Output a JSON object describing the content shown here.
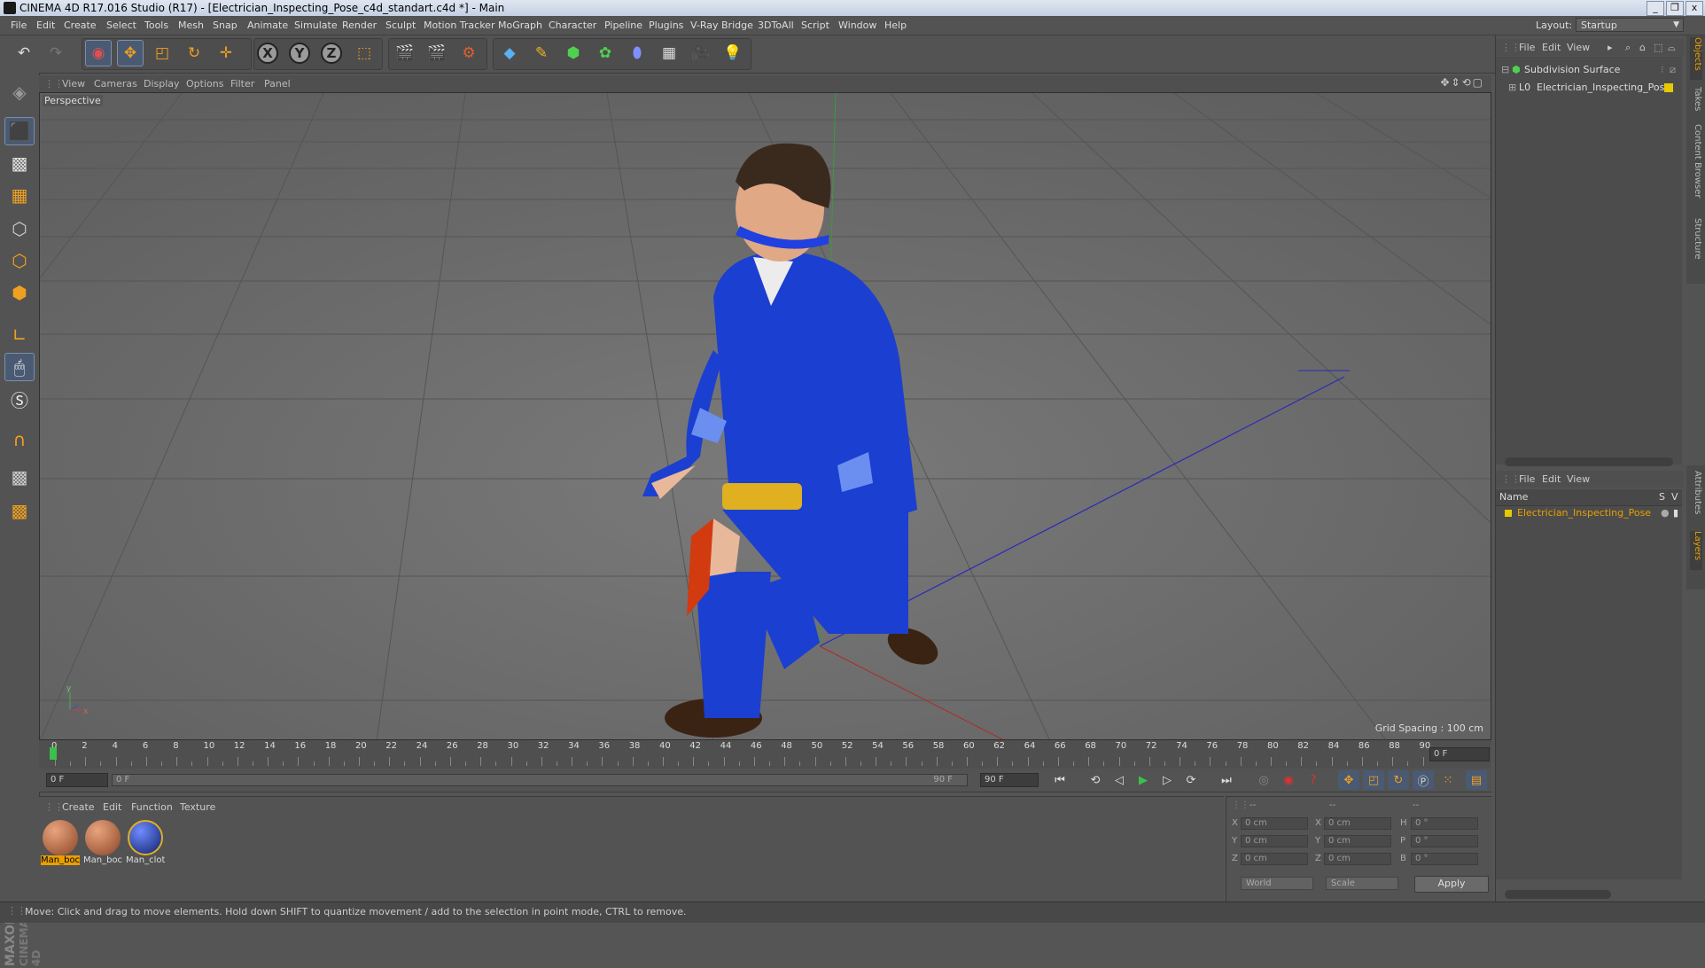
{
  "window": {
    "title": "CINEMA 4D R17.016 Studio (R17) - [Electrician_Inspecting_Pose_c4d_standart.c4d *] - Main",
    "controls": [
      "_",
      "❐",
      "x"
    ]
  },
  "menubar": {
    "items": [
      "File",
      "Edit",
      "Create",
      "Select",
      "Tools",
      "Mesh",
      "Snap",
      "Animate",
      "Simulate",
      "Render",
      "Sculpt",
      "Motion Tracker",
      "MoGraph",
      "Character",
      "Pipeline",
      "Plugins",
      "V-Ray Bridge",
      "3DToAll",
      "Script",
      "Window",
      "Help"
    ],
    "layout_label": "Layout:",
    "layout_value": "Startup"
  },
  "viewport": {
    "menu": [
      "View",
      "Cameras",
      "Display",
      "Options",
      "Filter",
      "Panel"
    ],
    "camera_label": "Perspective",
    "grid_spacing": "Grid Spacing : 100 cm"
  },
  "timeline": {
    "ticks": [
      "0",
      "2",
      "4",
      "6",
      "8",
      "10",
      "12",
      "14",
      "16",
      "18",
      "20",
      "22",
      "24",
      "26",
      "28",
      "30",
      "32",
      "34",
      "36",
      "38",
      "40",
      "42",
      "44",
      "46",
      "48",
      "50",
      "52",
      "54",
      "56",
      "58",
      "60",
      "62",
      "64",
      "66",
      "68",
      "70",
      "72",
      "74",
      "76",
      "78",
      "80",
      "82",
      "84",
      "86",
      "88",
      "90"
    ],
    "current_frame": "0 F"
  },
  "transport": {
    "start_field": "0 F",
    "slider_start": "0 F",
    "slider_end": "90 F",
    "end_field": "90 F"
  },
  "material_manager": {
    "menu": [
      "Create",
      "Edit",
      "Function",
      "Texture"
    ],
    "materials": [
      {
        "name": "Man_boc",
        "color": "#b06a45"
      },
      {
        "name": "Man_boc",
        "color": "#b06a45"
      },
      {
        "name": "Man_clot",
        "color": "#2748b8"
      }
    ]
  },
  "coordinates": {
    "col_headers": [
      "--",
      "--",
      "--"
    ],
    "rows": [
      {
        "a": "X",
        "av": "0 cm",
        "b": "X",
        "bv": "0 cm",
        "c": "H",
        "cv": "0 °"
      },
      {
        "a": "Y",
        "av": "0 cm",
        "b": "Y",
        "bv": "0 cm",
        "c": "P",
        "cv": "0 °"
      },
      {
        "a": "Z",
        "av": "0 cm",
        "b": "Z",
        "bv": "0 cm",
        "c": "B",
        "cv": "0 °"
      }
    ],
    "mode": "World",
    "scale": "Scale",
    "apply": "Apply"
  },
  "object_manager": {
    "menu": [
      "File",
      "Edit",
      "View"
    ],
    "objects": [
      {
        "name": "Subdivision Surface"
      },
      {
        "name": "Electrician_Inspecting_Pose"
      }
    ],
    "side_tabs": [
      "Objects",
      "Takes",
      "Content Browser",
      "Structure"
    ]
  },
  "layer_manager": {
    "menu": [
      "File",
      "Edit",
      "View"
    ],
    "header_name": "Name",
    "header_s": "S",
    "header_v": "V",
    "layers": [
      {
        "name": "Electrician_Inspecting_Pose",
        "color": "#e8c800"
      }
    ],
    "side_tabs": [
      "Attributes",
      "Layers"
    ]
  },
  "status": {
    "text": "Move: Click and drag to move elements. Hold down SHIFT to quantize movement / add to the selection in point mode, CTRL to remove."
  },
  "colors": {
    "accent": "#e8a000",
    "selection": "#4a5a72",
    "viewport_bg": "#6b6b6b",
    "uniform_blue": "#1b3fd0"
  },
  "icons": {
    "toolbar": [
      "undo-icon",
      "redo-icon",
      "live-select-icon",
      "move-icon",
      "scale-icon",
      "rotate-icon",
      "multi-transform-icon",
      "x-axis-icon",
      "y-axis-icon",
      "z-axis-icon",
      "coordinate-system-icon",
      "render-view-icon",
      "render-picture-viewer-icon",
      "edit-render-settings-icon",
      "cube-icon",
      "pen-icon",
      "subdivision-icon",
      "mograph-icon",
      "deformer-icon",
      "floor-icon",
      "camera-icon",
      "light-icon"
    ],
    "left": [
      "make-editable-icon",
      "model-mode-icon",
      "texture-mode-icon",
      "workplane-icon",
      "points-mode-icon",
      "edges-mode-icon",
      "polygons-mode-icon",
      "enable-axis-icon",
      "tweak-mode-icon",
      "solo-icon",
      "snap-icon",
      "workplane-lock-icon",
      "planar-icon"
    ]
  }
}
